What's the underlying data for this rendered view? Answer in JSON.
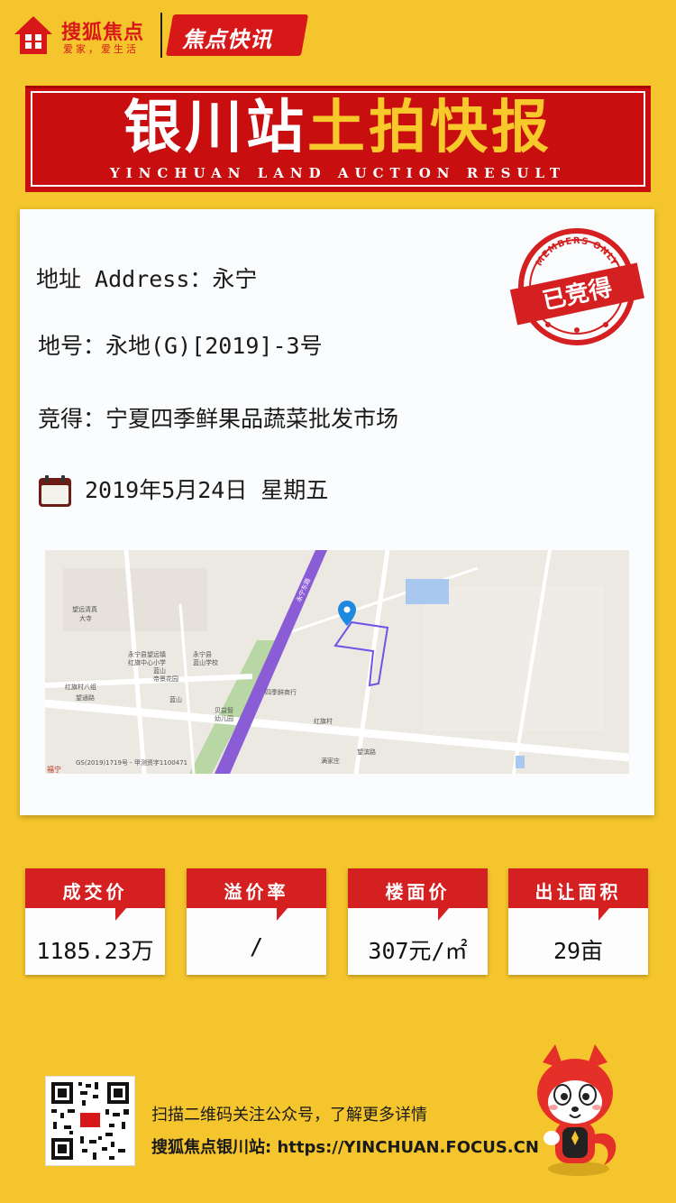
{
  "header": {
    "logo_name": "搜狐焦点",
    "logo_slogan": "爱家，爱生活",
    "badge": "焦点快讯"
  },
  "banner": {
    "title_white": "银川站",
    "title_yellow": "土拍快报",
    "subtitle": "YINCHUAN LAND AUCTION RESULT"
  },
  "info": {
    "address": "地址 Address：永宁",
    "lot": "地号：永地(G)[2019]-3号",
    "winner": "竞得：宁夏四季鲜果品蔬菜批发市场",
    "date": "2019年5月24日  星期五",
    "stamp_top": "MEMBERS ONLY",
    "stamp_main": "已竞得"
  },
  "map": {
    "labels": {
      "l1": "望远清真",
      "l2": "大寺",
      "l3": "永宁县望远镇",
      "l4": "红旗中心小学",
      "l5": "永宁县",
      "l6": "蓝山学校",
      "l7": "蓝山",
      "l8": "帝景花园",
      "l9": "红旗村八组",
      "l10": "望通路",
      "l11": "蓝山",
      "l12": "四季鲜商行",
      "l13": "贝益智",
      "l14": "幼儿园",
      "l15": "红旗村",
      "l16": "望滨路",
      "l17": "满家庄",
      "l18": "GS(2019)1719号 - 甲测资字1100471",
      "l19": "福宁",
      "l20": "永宁东路"
    }
  },
  "stats": [
    {
      "label": "成交价",
      "value": "1185.23万"
    },
    {
      "label": "溢价率",
      "value": "/"
    },
    {
      "label": "楼面价",
      "value": "307元/㎡"
    },
    {
      "label": "出让面积",
      "value": "29亩"
    }
  ],
  "footer": {
    "line1": "扫描二维码关注公众号，了解更多详情",
    "line2": "搜狐焦点银川站: https://YINCHUAN.FOCUS.CN"
  },
  "colors": {
    "background": "#f4c52c",
    "brand_red": "#c80e0e",
    "accent_yellow": "#f7c92a"
  }
}
